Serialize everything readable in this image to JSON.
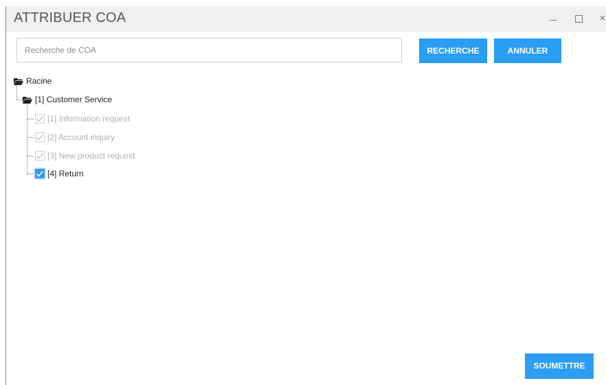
{
  "window": {
    "title": "ATTRIBUER COA",
    "controls": {
      "minimize": "minimize-icon",
      "maximize": "maximize-icon",
      "close": "close-icon",
      "close_glyph": "×"
    }
  },
  "search": {
    "placeholder": "Recherche de COA",
    "value": ""
  },
  "buttons": {
    "search_label": "RECHERCHE",
    "cancel_label": "ANNULER",
    "submit_label": "SOUMETTRE"
  },
  "tree": {
    "root": {
      "label": "Racine",
      "icon": "folder-open-icon"
    },
    "group": {
      "label": "[1] Customer Service",
      "icon": "folder-open-icon"
    },
    "items": [
      {
        "label": "[1] Information request",
        "checked": true,
        "disabled": true
      },
      {
        "label": "[2] Account inquiry",
        "checked": true,
        "disabled": true
      },
      {
        "label": "[3] New product request",
        "checked": true,
        "disabled": true
      },
      {
        "label": "[4] Return",
        "checked": true,
        "disabled": false
      }
    ]
  },
  "colors": {
    "accent": "#2a9df4",
    "titlebar": "#f0f0f0",
    "disabled_text": "#b0b0b0"
  }
}
